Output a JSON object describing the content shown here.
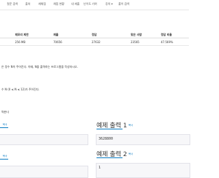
{
  "nav": {
    "items": [
      "질문 검색",
      "출처",
      "재채점",
      "채점 현황",
      "내 제출",
      "난이도 기여",
      "강의",
      "풀이 검색"
    ]
  },
  "stats_table": {
    "headers": [
      "메모리 제한",
      "제출",
      "정답",
      "맞은 사람",
      "정답 비율"
    ],
    "row": [
      "256 MB",
      "70656",
      "27632",
      "23565",
      "47.569%"
    ]
  },
  "problem": {
    "desc_line": "은 정수 N이 주어진다. 이때, N을 출력하는 프로그램을 작성하시오.",
    "input_line": "수 N (0 ≤ N ≤ 12)가 주어진다.",
    "output_heading": "력한다"
  },
  "samples": {
    "input1_copy": "복사",
    "output1_title": "예제 출력 1",
    "output1_copy": "복사",
    "output1_value": "3628800",
    "input2_copy": "복사",
    "output2_title": "예제 출력 2",
    "output2_copy": "복사",
    "output2_value": "1"
  }
}
